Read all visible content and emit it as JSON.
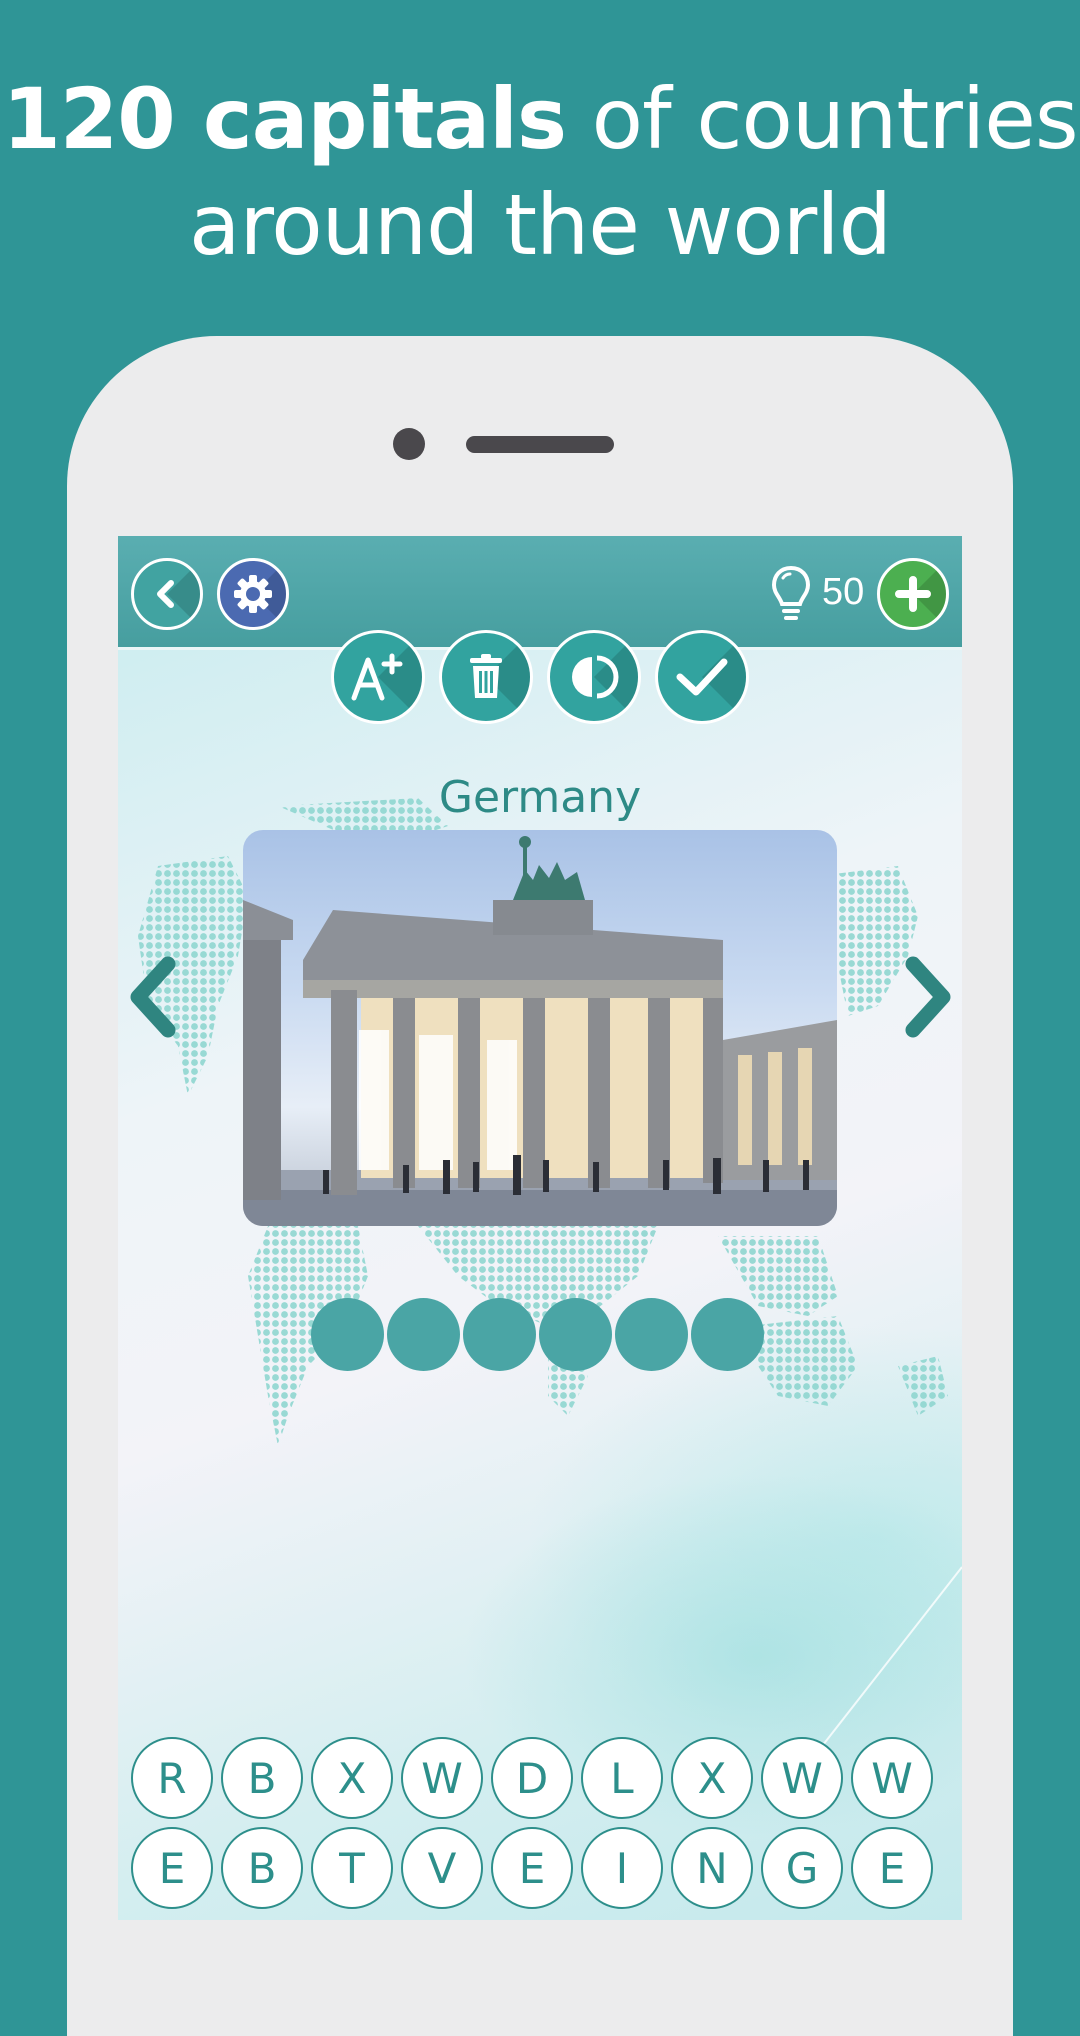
{
  "promo": {
    "headline_bold": "120 capitals",
    "headline_rest_line1": " of countries",
    "headline_line2": "around the world"
  },
  "topbar": {
    "back_icon": "chevron-left-icon",
    "settings_icon": "gear-icon",
    "hint_icon": "lightbulb-icon",
    "hint_count": "50",
    "add_hints_icon": "plus-icon"
  },
  "tools": [
    {
      "name": "reveal-letter",
      "icon": "A+"
    },
    {
      "name": "remove-letters",
      "icon": "trash-icon"
    },
    {
      "name": "half-hint",
      "icon": "contrast-icon"
    },
    {
      "name": "solve",
      "icon": "checkmark-icon"
    }
  ],
  "question": {
    "country": "Germany",
    "image_description": "Brandenburg Gate"
  },
  "answer": {
    "length": 6,
    "slots": [
      "",
      "",
      "",
      "",
      "",
      ""
    ]
  },
  "keyboard": {
    "rows": [
      [
        "R",
        "B",
        "X",
        "W",
        "D",
        "L",
        "X",
        "W",
        "W"
      ],
      [
        "E",
        "B",
        "T",
        "V",
        "E",
        "I",
        "N",
        "G",
        "E"
      ]
    ]
  },
  "colors": {
    "background": "#2f9596",
    "topbar": "#55aaad",
    "accent": "#2d8f8b",
    "settings": "#4b6ab1",
    "add": "#4caf50"
  }
}
